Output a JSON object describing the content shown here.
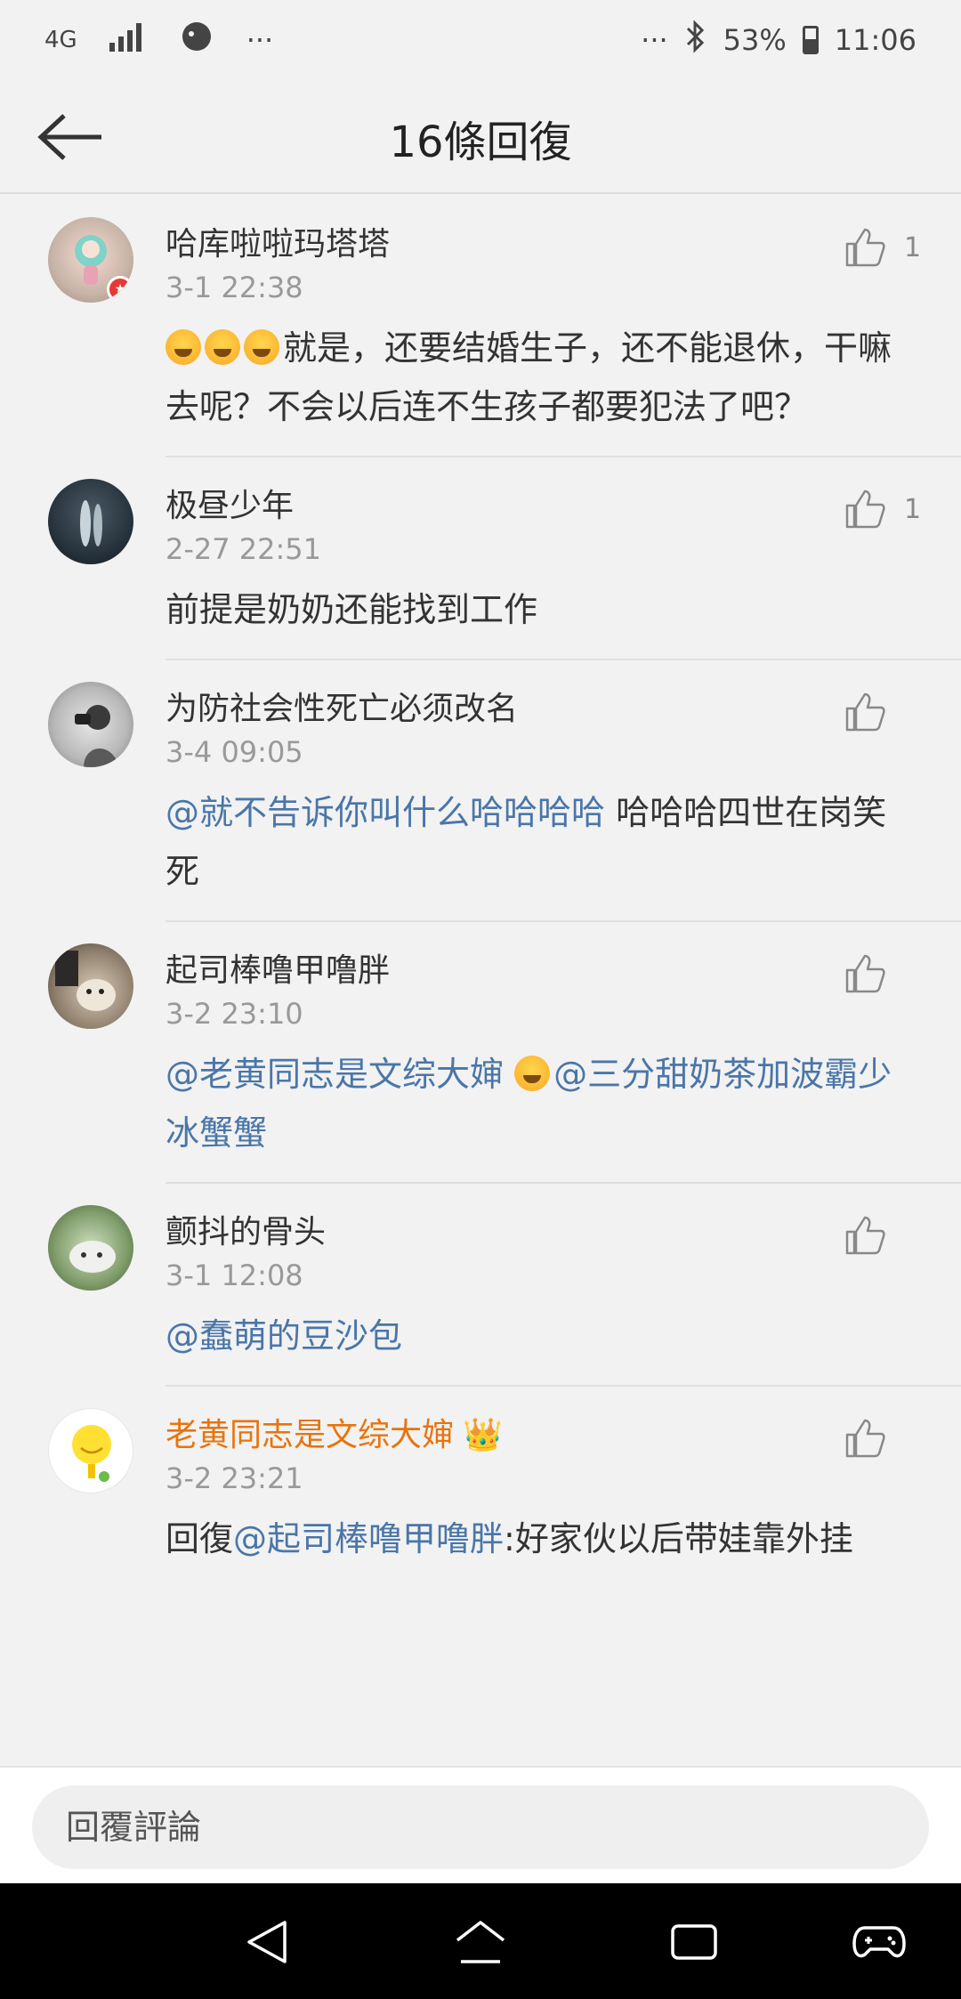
{
  "status_bar": {
    "network": "4G",
    "dots": "···",
    "battery_percent": "53%",
    "time": "11:06",
    "battery_level": 0.53
  },
  "header": {
    "title": "16條回復"
  },
  "comments": [
    {
      "name": "哈库啦啦玛塔塔",
      "time": "3-1 22:38",
      "like_count": "1",
      "text_parts": [
        {
          "type": "emoji",
          "name": "laugh-cry-emoji"
        },
        {
          "type": "emoji",
          "name": "laugh-cry-emoji"
        },
        {
          "type": "emoji",
          "name": "laugh-cry-emoji"
        },
        {
          "type": "text",
          "value": "就是，还要结婚生子，还不能退休，干嘛去呢？不会以后连不生孩子都要犯法了吧？"
        }
      ]
    },
    {
      "name": "极昼少年",
      "time": "2-27 22:51",
      "like_count": "1",
      "text_parts": [
        {
          "type": "text",
          "value": "前提是奶奶还能找到工作"
        }
      ]
    },
    {
      "name": "为防社会性死亡必须改名",
      "time": "3-4 09:05",
      "like_count": "",
      "text_parts": [
        {
          "type": "mention",
          "value": "@就不告诉你叫什么哈哈哈哈"
        },
        {
          "type": "text",
          "value": " 哈哈哈四世在岗笑死"
        }
      ]
    },
    {
      "name": "起司棒噜甲噜胖",
      "time": "3-2 23:10",
      "like_count": "",
      "text_parts": [
        {
          "type": "mention",
          "value": "@老黄同志是文综大婶 "
        },
        {
          "type": "emoji",
          "name": "laugh-cry-emoji"
        },
        {
          "type": "mention",
          "value": "@三分甜奶茶加波霸少冰蟹蟹"
        }
      ]
    },
    {
      "name": "颤抖的骨头",
      "time": "3-1 12:08",
      "like_count": "",
      "text_parts": [
        {
          "type": "mention",
          "value": "@蠢萌的豆沙包"
        }
      ]
    },
    {
      "name": "老黄同志是文综大婶",
      "time": "3-2 23:21",
      "like_count": "",
      "vip": true,
      "text_parts": [
        {
          "type": "text",
          "value": "回復"
        },
        {
          "type": "mention",
          "value": "@起司棒噜甲噜胖"
        },
        {
          "type": "text",
          "value": ":好家伙以后带娃靠外挂"
        }
      ]
    }
  ],
  "reply": {
    "placeholder": "回覆評論"
  },
  "colors": {
    "mention": "#4a76a8",
    "vip_name": "#e8740c",
    "background": "#f2f2f2"
  }
}
